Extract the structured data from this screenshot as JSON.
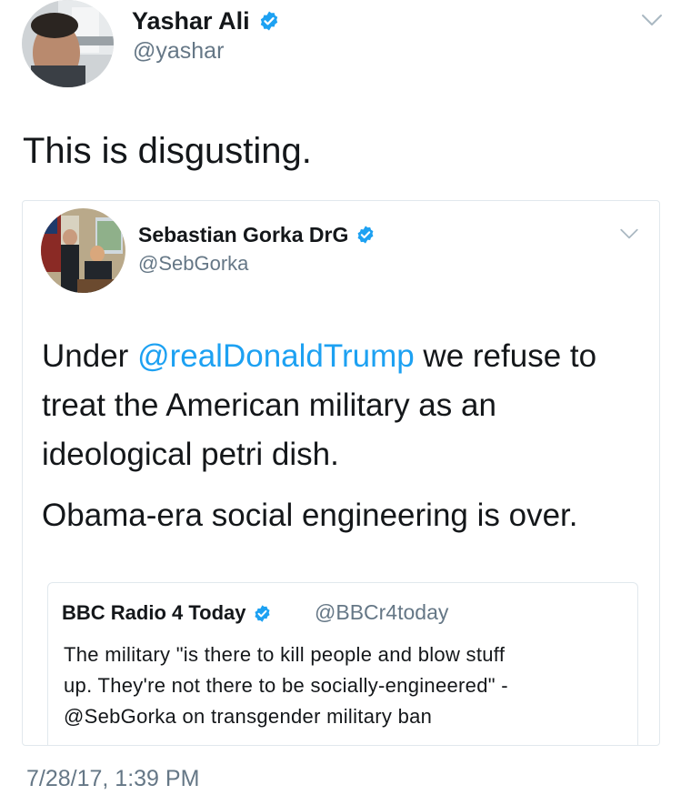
{
  "colors": {
    "text": "#14171a",
    "secondary": "#657786",
    "link": "#1da1f2",
    "verified": "#1da1f2",
    "border": "#e1e8ed"
  },
  "tweet": {
    "author_name": "Yashar Ali",
    "author_handle": "@yashar",
    "text": "This is disgusting.",
    "timestamp": "7/28/17, 1:39 PM",
    "icons": [
      "verified-badge-icon",
      "chevron-down-icon"
    ]
  },
  "quoted_tweet": {
    "author_name": "Sebastian Gorka DrG",
    "author_handle": "@SebGorka",
    "text_part1_before": "Under ",
    "mention": "@realDonaldTrump",
    "text_part1_line1_after": " we refuse to",
    "text_part1_line2": "treat the American military as an",
    "text_part1_line3": "ideological petri dish.",
    "text_part2": "Obama-era social engineering is over."
  },
  "nested_quote": {
    "author_name": "BBC Radio 4 Today",
    "author_handle": "@BBCr4today",
    "lines": [
      "The military \"is there to kill people and blow stuff",
      "up. They're not there to be socially-engineered\" -",
      "@SebGorka on transgender military ban"
    ]
  }
}
